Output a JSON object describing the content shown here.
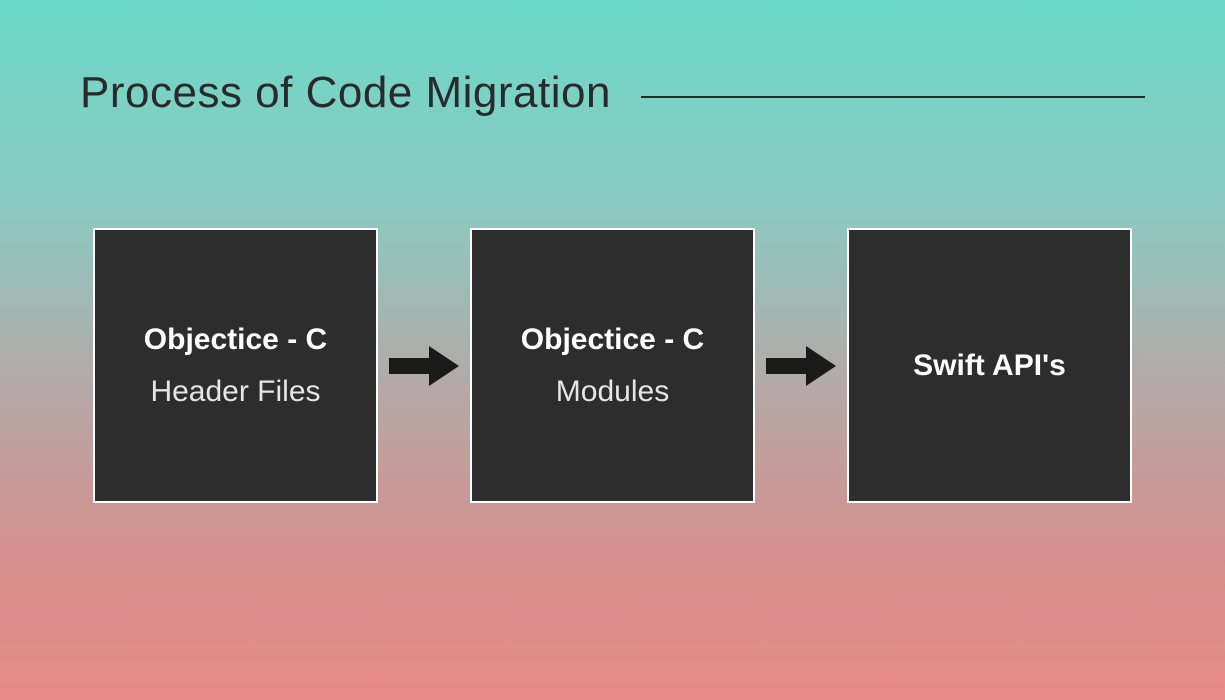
{
  "title": "Process of Code Migration",
  "boxes": [
    {
      "title": "Objectice - C",
      "subtitle": "Header Files"
    },
    {
      "title": "Objectice - C",
      "subtitle": "Modules"
    },
    {
      "title": "Swift API's",
      "subtitle": ""
    }
  ]
}
